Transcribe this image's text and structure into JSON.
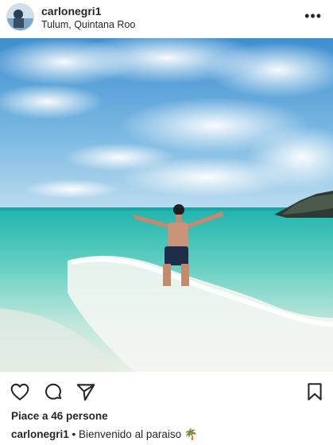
{
  "post": {
    "username": "carlonegri1",
    "location": "Tulum, Quintana Roo",
    "more_label": "•••",
    "likes_text": "Piace a 46 persone",
    "caption_separator": " • ",
    "caption_text": "Bienvenido al paraiso",
    "caption_emoji": "🌴"
  },
  "icons": {
    "like": "heart-icon",
    "comment": "comment-icon",
    "share": "paper-plane-icon",
    "save": "bookmark-icon",
    "more": "more-options-icon"
  },
  "colors": {
    "text": "#262626",
    "sky": "#4b9bd6",
    "sea": "#27b8b0"
  }
}
